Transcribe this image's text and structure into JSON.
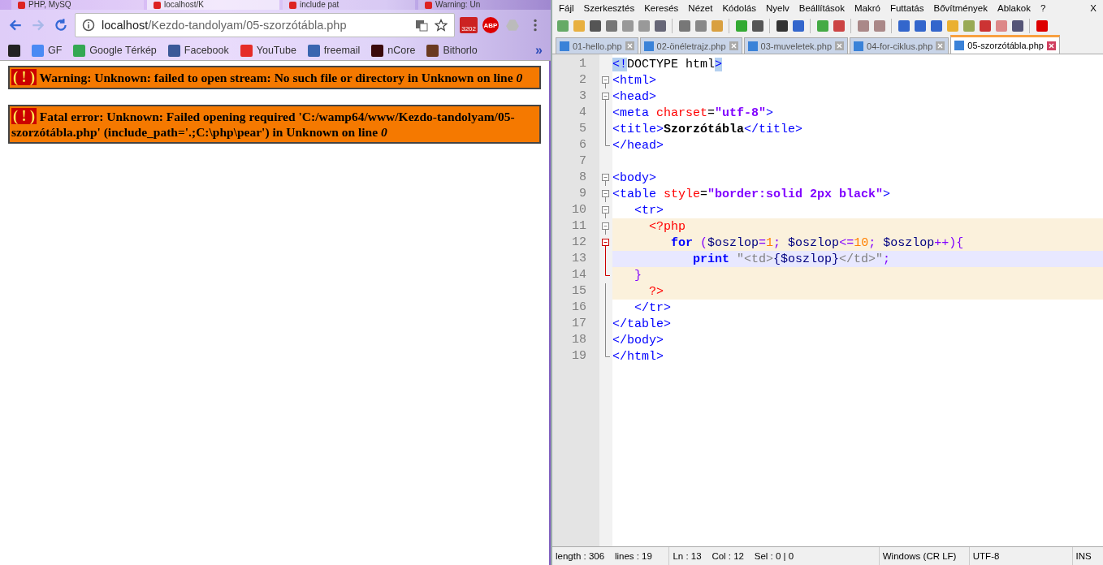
{
  "browser": {
    "tabs": [
      {
        "label": "PHP, MySQ",
        "selected": false
      },
      {
        "label": "localhost/K",
        "selected": true
      },
      {
        "label": "include pat",
        "selected": false
      },
      {
        "label": "Warning: Un",
        "selected": false
      }
    ],
    "address": "localhost",
    "address_path": "/Kezdo-tandolyam/05-szorzótábla.php",
    "mail_badge": "3202",
    "adblock_badge": "ABP",
    "bookmarks": [
      {
        "kind": "apps"
      },
      {
        "label": "GF",
        "kind": "translate"
      },
      {
        "label": "Google Térkép",
        "kind": "maps"
      },
      {
        "label": "Facebook",
        "kind": "facebook"
      },
      {
        "label": "YouTube",
        "kind": "youtube"
      },
      {
        "label": "freemail",
        "kind": "freemail"
      },
      {
        "label": "nCore",
        "kind": "ncore"
      },
      {
        "label": "Bithorlo",
        "kind": "bithorlo"
      }
    ],
    "bookmarks_more": "»",
    "errors": [
      {
        "icon": "( ! )",
        "message": "Warning: Unknown: failed to open stream: No such file or directory in Unknown on line",
        "line": "0"
      },
      {
        "icon": "( ! )",
        "message": "Fatal error: Unknown: Failed opening required 'C:/wamp64/www/Kezdo-tandolyam/05-szorzótábla.php' (include_path='.;C:\\php\\pear') in Unknown on line",
        "line": "0"
      }
    ]
  },
  "editor": {
    "menu": [
      "Fájl",
      "Szerkesztés",
      "Keresés",
      "Nézet",
      "Kódolás",
      "Nyelv",
      "Beállítások",
      "Makró",
      "Futtatás",
      "Bővítmények",
      "Ablakok",
      "?"
    ],
    "close": "X",
    "tabs": [
      {
        "label": "01-hello.php",
        "selected": false
      },
      {
        "label": "02-önéletrajz.php",
        "selected": false
      },
      {
        "label": "03-muveletek.php",
        "selected": false
      },
      {
        "label": "04-for-ciklus.php",
        "selected": false
      },
      {
        "label": "05-szorzótábla.php",
        "selected": true
      }
    ],
    "lines": [
      {
        "number": "1",
        "current": false,
        "php": false,
        "tokens": [
          {
            "t": "<!",
            "kind": "match"
          },
          {
            "t": "DOCTYPE html",
            "kind": "plain"
          },
          {
            "t": ">",
            "kind": "match"
          }
        ]
      },
      {
        "number": "2",
        "kind": "open",
        "current": false,
        "php": false,
        "tokens": [
          {
            "t": "<html>",
            "kind": "tag"
          }
        ]
      },
      {
        "number": "3",
        "kind": "open",
        "current": false,
        "php": false,
        "tokens": [
          {
            "t": "<head>",
            "kind": "tag"
          }
        ]
      },
      {
        "number": "4",
        "kind": "line",
        "current": false,
        "php": false,
        "tokens": [
          {
            "t": "<meta ",
            "kind": "tag"
          },
          {
            "t": "charset",
            "kind": "attr"
          },
          {
            "t": "=",
            "kind": "plain"
          },
          {
            "t": "\"utf-8\"",
            "kind": "str"
          },
          {
            "t": ">",
            "kind": "tag"
          }
        ]
      },
      {
        "number": "5",
        "kind": "line",
        "current": false,
        "php": false,
        "tokens": [
          {
            "t": "<title>",
            "kind": "tag"
          },
          {
            "t": "Szorzótábla",
            "kind": "bold"
          },
          {
            "t": "</title>",
            "kind": "tag"
          }
        ]
      },
      {
        "number": "6",
        "kind": "end",
        "current": false,
        "php": false,
        "tokens": [
          {
            "t": "</head>",
            "kind": "tag"
          }
        ]
      },
      {
        "number": "7",
        "current": false,
        "php": false
      },
      {
        "number": "8",
        "kind": "open",
        "current": false,
        "php": false,
        "tokens": [
          {
            "t": "<body>",
            "kind": "tag"
          }
        ]
      },
      {
        "number": "9",
        "kind": "open",
        "current": false,
        "php": false,
        "tokens": [
          {
            "t": "<table ",
            "kind": "tag"
          },
          {
            "t": "style",
            "kind": "attr"
          },
          {
            "t": "=",
            "kind": "plain"
          },
          {
            "t": "\"border:solid 2px black\"",
            "kind": "str"
          },
          {
            "t": ">",
            "kind": "tag"
          }
        ]
      },
      {
        "number": "10",
        "kind": "open",
        "current": false,
        "php": false,
        "tokens": [
          {
            "t": "   <tr>",
            "kind": "tag"
          }
        ]
      },
      {
        "number": "11",
        "kind": "open",
        "current": false,
        "php": true,
        "tokens": [
          {
            "t": "     <?php",
            "kind": "phpdelim"
          }
        ]
      },
      {
        "number": "12",
        "kind": "openred",
        "current": false,
        "php": true,
        "tokens": [
          {
            "t": "        for",
            "kind": "keyword"
          },
          {
            "t": " (",
            "kind": "op"
          },
          {
            "t": "$oszlop",
            "kind": "var"
          },
          {
            "t": "=",
            "kind": "op"
          },
          {
            "t": "1",
            "kind": "num"
          },
          {
            "t": "; ",
            "kind": "op"
          },
          {
            "t": "$oszlop",
            "kind": "var"
          },
          {
            "t": "<=",
            "kind": "op"
          },
          {
            "t": "10",
            "kind": "num"
          },
          {
            "t": "; ",
            "kind": "op"
          },
          {
            "t": "$oszlop",
            "kind": "var"
          },
          {
            "t": "++){",
            "kind": "op"
          }
        ]
      },
      {
        "number": "13",
        "kind": "linered",
        "current": true,
        "php": true,
        "tokens": [
          {
            "t": "           print",
            "kind": "keyword"
          },
          {
            "t": " \"<td>",
            "kind": "phpstr"
          },
          {
            "t": "{$oszlop}",
            "kind": "var"
          },
          {
            "t": "</td>\"",
            "kind": "phpstr"
          },
          {
            "t": ";",
            "kind": "op"
          }
        ]
      },
      {
        "number": "14",
        "kind": "endred",
        "current": false,
        "php": true,
        "tokens": [
          {
            "t": "   }",
            "kind": "op"
          }
        ]
      },
      {
        "number": "15",
        "kind": "line",
        "current": false,
        "php": true,
        "tokens": [
          {
            "t": "     ?>",
            "kind": "phpdelim"
          }
        ]
      },
      {
        "number": "16",
        "kind": "line",
        "current": false,
        "php": false,
        "tokens": [
          {
            "t": "   </tr>",
            "kind": "tag"
          }
        ]
      },
      {
        "number": "17",
        "kind": "line",
        "current": false,
        "php": false,
        "tokens": [
          {
            "t": "</table>",
            "kind": "tag"
          }
        ]
      },
      {
        "number": "18",
        "kind": "line",
        "current": false,
        "php": false,
        "tokens": [
          {
            "t": "</body>",
            "kind": "tag"
          }
        ]
      },
      {
        "number": "19",
        "kind": "end",
        "current": false,
        "php": false,
        "tokens": [
          {
            "t": "</html>",
            "kind": "tag"
          }
        ]
      }
    ],
    "status": [
      "length : 306    lines : 19",
      "Ln : 13    Col : 12    Sel : 0 | 0",
      "Windows (CR LF)",
      "UTF-8",
      "INS"
    ]
  }
}
